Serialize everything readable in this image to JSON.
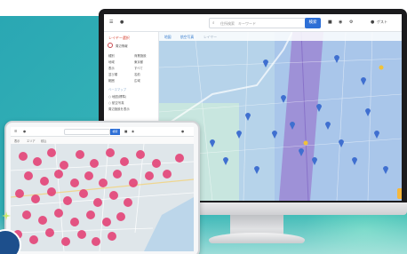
{
  "colors": {
    "background_teal": "#35b3b7",
    "search_button": "#2d6fd6",
    "sidebar_title": "#d84a3a",
    "pin_blue": "#3f6fd0",
    "pin_pink": "#e43f74",
    "tab_label": "#3a7fcf"
  },
  "desktop": {
    "topbar": {
      "menu_icon": "hamburger-icon",
      "search_placeholder": "住所検索　キーワード",
      "search_button_label": "検索",
      "account_label": "ゲスト",
      "icons": [
        "layers-icon",
        "pin-icon",
        "settings-icon"
      ]
    },
    "sidebar": {
      "title": "レイヤー選択",
      "section": "周辺情報",
      "rows": [
        {
          "label": "種別",
          "value": "商業施設"
        },
        {
          "label": "地域",
          "value": "東京都"
        },
        {
          "label": "表示",
          "value": "すべて"
        },
        {
          "label": "並び順",
          "value": "名前"
        },
        {
          "label": "範囲",
          "value": "広域"
        }
      ],
      "subsection": "ベースマップ",
      "options": [
        "地図(標準)",
        "航空写真"
      ],
      "extra": "周辺施設を表示"
    },
    "map_tabs": [
      "地図",
      "航空写真",
      "レイヤー"
    ]
  },
  "tablet": {
    "topbar": {
      "search_button_label": "検索",
      "left_label": "表示"
    },
    "subbar_labels": [
      "エリア",
      "絞込"
    ]
  }
}
